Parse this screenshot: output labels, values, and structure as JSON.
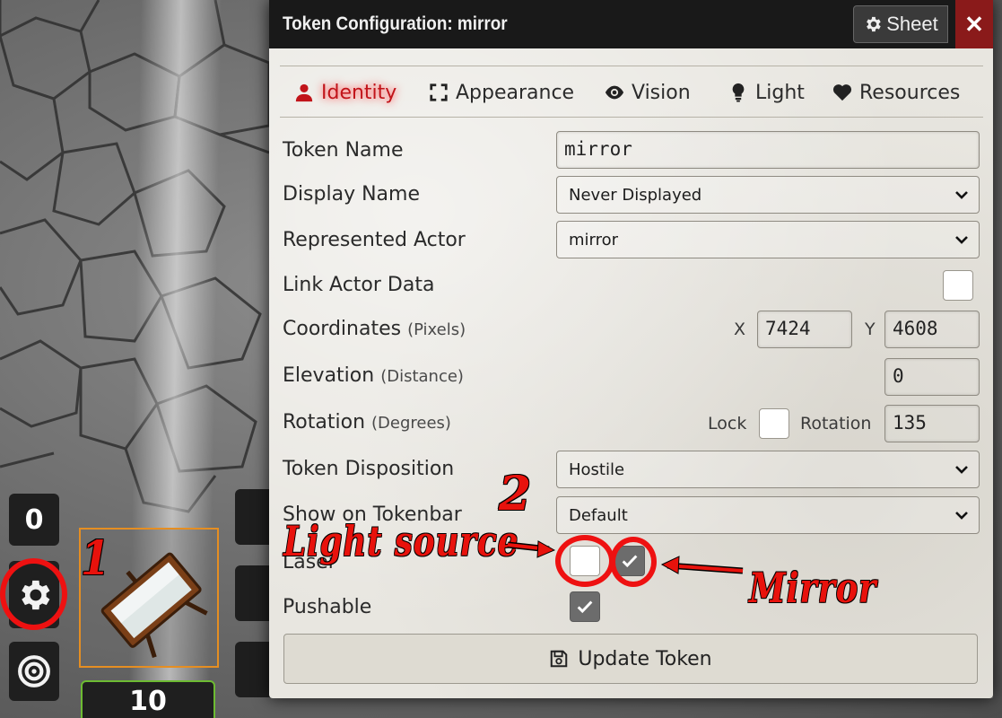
{
  "dialog": {
    "title": "Token Configuration: mirror",
    "sheet_label": "Sheet",
    "close_label": "✕"
  },
  "tabs": [
    {
      "label": "Identity",
      "icon": "user-icon",
      "active": true
    },
    {
      "label": "Appearance",
      "icon": "expand-icon",
      "active": false
    },
    {
      "label": "Vision",
      "icon": "eye-icon",
      "active": false
    },
    {
      "label": "Light",
      "icon": "lightbulb-icon",
      "active": false
    },
    {
      "label": "Resources",
      "icon": "heart-icon",
      "active": false
    }
  ],
  "form": {
    "token_name": {
      "label": "Token Name",
      "value": "mirror"
    },
    "display_name": {
      "label": "Display Name",
      "value": "Never Displayed"
    },
    "represented_actor": {
      "label": "Represented Actor",
      "value": "mirror"
    },
    "link_actor_data": {
      "label": "Link Actor Data",
      "checked": false
    },
    "coordinates": {
      "label": "Coordinates",
      "unit": "(Pixels)",
      "x_label": "X",
      "x": "7424",
      "y_label": "Y",
      "y": "4608"
    },
    "elevation": {
      "label": "Elevation",
      "unit": "(Distance)",
      "value": "0"
    },
    "rotation": {
      "label": "Rotation",
      "unit": "(Degrees)",
      "lock_label": "Lock",
      "lock_checked": false,
      "rotation_label": "Rotation",
      "value": "135"
    },
    "disposition": {
      "label": "Token Disposition",
      "value": "Hostile"
    },
    "tokenbar": {
      "label": "Show on Tokenbar",
      "value": "Default"
    },
    "laser": {
      "label": "Laser",
      "light_source_checked": false,
      "mirror_checked": true
    },
    "pushable": {
      "label": "Pushable",
      "checked": true
    },
    "update_label": "Update Token"
  },
  "hud": {
    "count": "0",
    "bar_value": "10"
  },
  "annotations": {
    "one": "1",
    "two": "2",
    "light_source": "Light source",
    "mirror": "Mirror"
  },
  "colors": {
    "accent_red": "#e8120c",
    "title_bg": "#191919",
    "token_border": "#e58e22",
    "bar_border": "#6dbb32"
  }
}
